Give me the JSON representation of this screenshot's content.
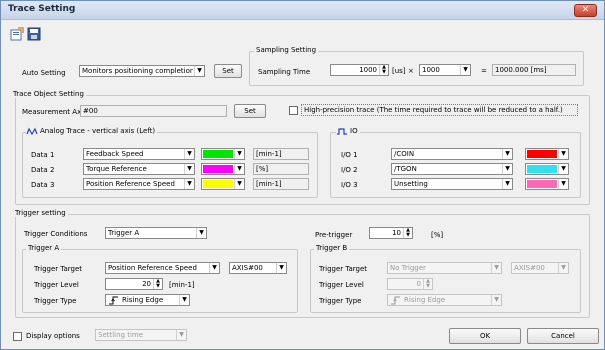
{
  "window": {
    "title": "Trace Setting",
    "close_glyph": "✕"
  },
  "toolbar": {
    "icons": [
      "open-file-icon",
      "save-icon"
    ]
  },
  "auto_setting": {
    "label": "Auto Setting",
    "value": "Monitors positioning completion (",
    "set_button": "Set"
  },
  "sampling": {
    "group_title": "Sampling Setting",
    "label": "Sampling Time",
    "value": "1000",
    "unit": "[us]",
    "times": "×",
    "multiplier": "1000",
    "equals": "=",
    "result": "1000.000 [ms]"
  },
  "trace_object": {
    "group_title": "Trace Object Setting",
    "measurement_axis_label": "Measurement Axis",
    "measurement_axis_value": "#00",
    "set_button": "Set",
    "high_precision_label": "High-precision trace (The time required to trace will be reduced to a half.)"
  },
  "analog": {
    "group_title": "Analog Trace - vertical axis (Left)",
    "rows": [
      {
        "label": "Data 1",
        "value": "Feedback Speed",
        "color": "#00e600",
        "unit": "[min-1]"
      },
      {
        "label": "Data 2",
        "value": "Torque Reference",
        "color": "#ff00ff",
        "unit": "[%]"
      },
      {
        "label": "Data 3",
        "value": "Position Reference Speed",
        "color": "#ffff00",
        "unit": "[min-1]"
      }
    ]
  },
  "io": {
    "group_title": "IO",
    "rows": [
      {
        "label": "I/O 1",
        "value": "/COIN",
        "color": "#ff0000"
      },
      {
        "label": "I/O 2",
        "value": "/TGON",
        "color": "#33e0f0"
      },
      {
        "label": "I/O 3",
        "value": "Unsetting",
        "color": "#ff66b3"
      }
    ]
  },
  "trigger": {
    "group_title": "Trigger setting",
    "conditions_label": "Trigger Conditions",
    "conditions_value": "Trigger A",
    "pretrigger_label": "Pre-trigger",
    "pretrigger_value": "10",
    "pretrigger_unit": "[%]",
    "a": {
      "title": "Trigger A",
      "target_label": "Trigger Target",
      "target_value": "Position Reference Speed",
      "axis_value": "AXIS#00",
      "level_label": "Trigger Level",
      "level_value": "20",
      "level_unit": "[min-1]",
      "type_label": "Trigger Type",
      "type_value": "Rising Edge"
    },
    "b": {
      "title": "Trigger B",
      "target_label": "Trigger Target",
      "target_value": "No Trigger",
      "axis_value": "AXIS#00",
      "level_label": "Trigger Level",
      "level_value": "0",
      "type_label": "Trigger Type",
      "type_value": "Rising Edge"
    }
  },
  "footer": {
    "display_options_label": "Display options",
    "display_options_value": "Settling time",
    "ok": "OK",
    "cancel": "Cancel"
  }
}
